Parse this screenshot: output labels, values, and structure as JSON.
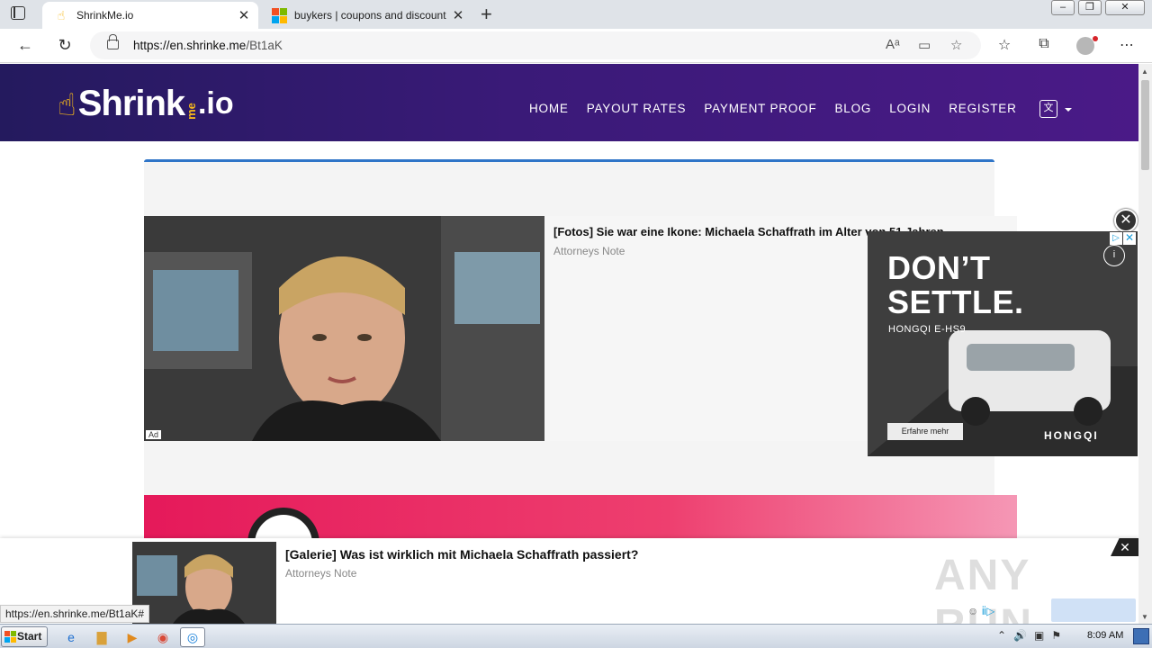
{
  "browser": {
    "tabs": [
      {
        "title": "ShrinkMe.io",
        "favicon": "hand-pointer-icon",
        "active": true
      },
      {
        "title": "buykers | coupons and discount c",
        "favicon": "microsoft-logo-icon",
        "active": false
      }
    ],
    "url_host": "https://en.shrinke.me",
    "url_path": "/Bt1aK"
  },
  "site": {
    "logo_shrink": "Shrink",
    "logo_me": "me",
    "logo_io": ".io",
    "nav": [
      "HOME",
      "PAYOUT RATES",
      "PAYMENT PROOF",
      "BLOG",
      "LOGIN",
      "REGISTER"
    ]
  },
  "ad_main": {
    "tag": "Ad",
    "headline": "[Fotos] Sie war eine Ikone: Michaela Schaffrath im Alter von 51 Jahren",
    "source": "Attorneys Note"
  },
  "side_ad": {
    "line1": "DON’T",
    "line2": "SETTLE.",
    "model": "HONGQI E-HS9",
    "cta": "Erfahre mehr",
    "brand": "HONGQI",
    "info": "i"
  },
  "sticky_ad": {
    "headline": "[Galerie] Was ist wirklich mit Michaela Schaffrath passiert?",
    "source": "Attorneys Note"
  },
  "status_bar_url": "https://en.shrinke.me/Bt1aK#",
  "watermark": "ANY RUN",
  "taskbar": {
    "start": "Start",
    "time": "8:09 AM"
  },
  "colors": {
    "header_start": "#241a5e",
    "header_end": "#4a1a87",
    "accent_blue": "#2f75c8",
    "logo_yellow": "#f6b81a",
    "banner_pink": "#e5195a"
  }
}
